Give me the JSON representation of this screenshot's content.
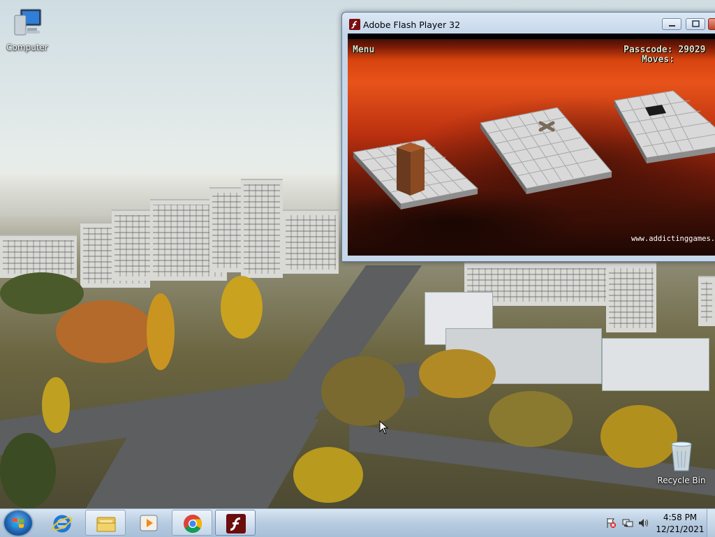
{
  "desktop": {
    "icons": [
      {
        "label": "Computer",
        "icon": "computer-icon"
      },
      {
        "label": "Recycle Bin",
        "icon": "recycle-bin-icon"
      }
    ]
  },
  "window": {
    "title": "Adobe Flash Player 32",
    "icon": "flash-player-icon",
    "controls": [
      "minimize",
      "maximize",
      "close"
    ]
  },
  "game": {
    "menu_label": "Menu",
    "passcode_label": "Passcode:",
    "passcode_value": "29029",
    "moves_label": "Moves:",
    "moves_value": "",
    "website": "www.addictinggames.com",
    "colors": {
      "background": "#d8440e",
      "tile": "#c9c9c9",
      "block": "#7a3a1a"
    }
  },
  "taskbar": {
    "start_icon": "windows-start-icon",
    "pinned": [
      {
        "name": "internet-explorer",
        "icon": "internet-explorer-icon"
      },
      {
        "name": "file-explorer",
        "icon": "folder-icon"
      },
      {
        "name": "media-player",
        "icon": "media-player-icon"
      },
      {
        "name": "chrome",
        "icon": "chrome-icon"
      },
      {
        "name": "flash-player",
        "icon": "flash-player-icon"
      }
    ],
    "tray_icons": [
      "action-center-icon",
      "network-icon",
      "volume-icon"
    ],
    "time": "4:58 PM",
    "date": "12/21/2021"
  }
}
